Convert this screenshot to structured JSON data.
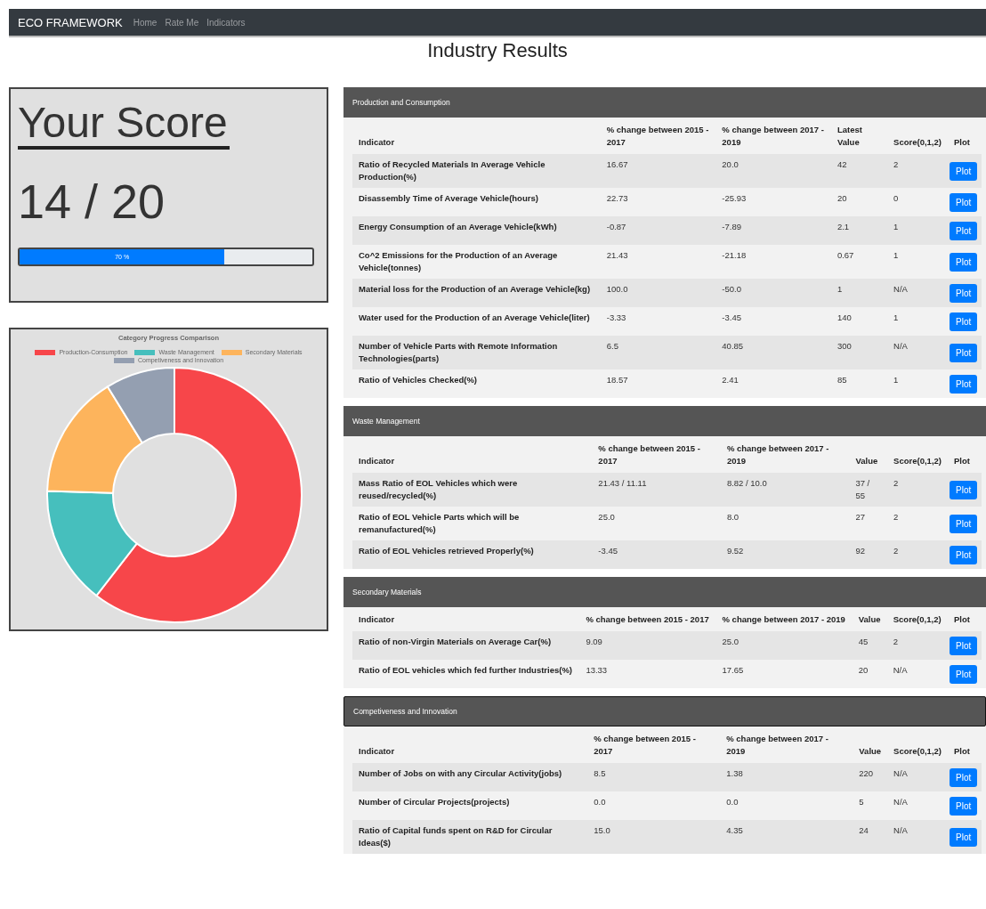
{
  "navbar": {
    "brand": "ECO FRAMEWORK",
    "links": [
      {
        "label": "Home"
      },
      {
        "label": "Rate Me"
      },
      {
        "label": "Indicators"
      }
    ]
  },
  "page_title": "Industry Results",
  "score_card": {
    "heading": "Your Score",
    "score": "14 / 20",
    "progress": {
      "level": 0.7,
      "label": "70 %"
    }
  },
  "category_chart": {
    "title": "Category Progress Comparison",
    "legend": [
      {
        "label": "Production-Consumption",
        "color": "#f7464a"
      },
      {
        "label": "Waste Management",
        "color": "#46bfbd"
      },
      {
        "label": "Secondary Materials",
        "color": "#fdb45c"
      },
      {
        "label": "Competiveness and Innovation",
        "color": "#949fb1"
      }
    ]
  },
  "sections": [
    {
      "title": "Production and Consumption",
      "outlined": false,
      "columns": [
        "Indicator",
        "% change between 2015 - 2017",
        "% change between 2017 - 2019",
        "Latest Value",
        "Score(0,1,2)",
        "Plot"
      ],
      "rows": [
        [
          "Ratio of Recycled Materials In Average Vehicle Production(%)",
          "16.67",
          "20.0",
          "42",
          "2",
          "Plot"
        ],
        [
          "Disassembly Time of Average Vehicle(hours)",
          "22.73",
          "-25.93",
          "20",
          "0",
          "Plot"
        ],
        [
          "Energy Consumption of an Average Vehicle(kWh)",
          "-0.87",
          "-7.89",
          "2.1",
          "1",
          "Plot"
        ],
        [
          "Co^2 Emissions for the Production of an Average Vehicle(tonnes)",
          "21.43",
          "-21.18",
          "0.67",
          "1",
          "Plot"
        ],
        [
          "Material loss for the Production of an Average Vehicle(kg)",
          "100.0",
          "-50.0",
          "1",
          "N/A",
          "Plot"
        ],
        [
          "Water used for the Production of an Average Vehicle(liter)",
          "-3.33",
          "-3.45",
          "140",
          "1",
          "Plot"
        ],
        [
          "Number of Vehicle Parts with Remote Information Technologies(parts)",
          "6.5",
          "40.85",
          "300",
          "N/A",
          "Plot"
        ],
        [
          "Ratio of Vehicles Checked(%)",
          "18.57",
          "2.41",
          "85",
          "1",
          "Plot"
        ]
      ]
    },
    {
      "title": "Waste Management",
      "outlined": false,
      "columns": [
        "Indicator",
        "% change between 2015 - 2017",
        "% change between 2017 - 2019",
        "Value",
        "Score(0,1,2)",
        "Plot"
      ],
      "rows": [
        [
          "Mass Ratio of EOL Vehicles which were reused/recycled(%)",
          "21.43 / 11.11",
          "8.82 / 10.0",
          "37 / 55",
          "2",
          "Plot"
        ],
        [
          "Ratio of EOL Vehicle Parts which will be remanufactured(%)",
          "25.0",
          "8.0",
          "27",
          "2",
          "Plot"
        ],
        [
          "Ratio of EOL Vehicles retrieved Properly(%)",
          "-3.45",
          "9.52",
          "92",
          "2",
          "Plot"
        ]
      ]
    },
    {
      "title": "Secondary Materials",
      "outlined": false,
      "columns": [
        "Indicator",
        "% change between 2015 - 2017",
        "% change between 2017 - 2019",
        "Value",
        "Score(0,1,2)",
        "Plot"
      ],
      "rows": [
        [
          "Ratio of non-Virgin Materials on Average Car(%)",
          "9.09",
          "25.0",
          "45",
          "2",
          "Plot"
        ],
        [
          "Ratio of EOL vehicles which fed further Industries(%)",
          "13.33",
          "17.65",
          "20",
          "N/A",
          "Plot"
        ]
      ]
    },
    {
      "title": "Competiveness and Innovation",
      "outlined": true,
      "columns": [
        "Indicator",
        "% change between 2015 - 2017",
        "% change between 2017 - 2019",
        "Value",
        "Score(0,1,2)",
        "Plot"
      ],
      "rows": [
        [
          "Number of Jobs on with any Circular Activity(jobs)",
          "8.5",
          "1.38",
          "220",
          "N/A",
          "Plot"
        ],
        [
          "Number of Circular Projects(projects)",
          "0.0",
          "0.0",
          "5",
          "N/A",
          "Plot"
        ],
        [
          "Ratio of Capital funds spent on R&D for Circular Ideas($)",
          "15.0",
          "4.35",
          "24",
          "N/A",
          "Plot"
        ]
      ]
    }
  ]
}
